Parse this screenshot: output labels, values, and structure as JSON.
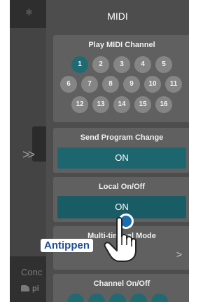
{
  "background_app": {
    "label_concert": "Conc",
    "label_piano": "pi"
  },
  "panel": {
    "title": "MIDI"
  },
  "play_midi_channel": {
    "title": "Play MIDI Channel",
    "selected": "1",
    "channels": [
      "1",
      "2",
      "3",
      "4",
      "5",
      "6",
      "7",
      "8",
      "9",
      "10",
      "11",
      "12",
      "13",
      "14",
      "15",
      "16"
    ]
  },
  "send_program_change": {
    "title": "Send Program Change",
    "value": "ON"
  },
  "local_on_off": {
    "title": "Local On/Off",
    "value": "ON"
  },
  "multi_timbral_mode": {
    "title": "Multi-timbral Mode"
  },
  "channel_on_off": {
    "title": "Channel On/Off"
  },
  "hint": {
    "label": "Antippen"
  },
  "colors": {
    "accent": "#1d6670",
    "selected_channel": "#206a73",
    "hint_text": "#1f4e96",
    "tap_marker": "#1a6dad"
  }
}
